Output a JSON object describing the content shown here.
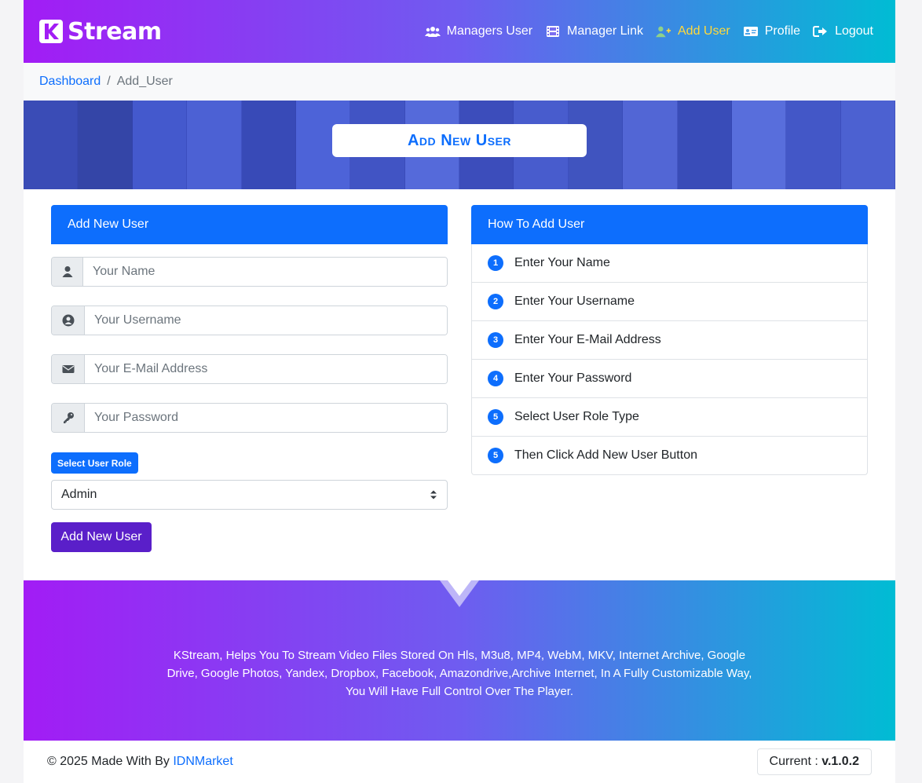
{
  "brand": {
    "name": "Stream"
  },
  "nav": {
    "items": [
      {
        "label": "Managers User",
        "icon": "users-icon"
      },
      {
        "label": "Manager Link",
        "icon": "film-icon"
      },
      {
        "label": "Add User",
        "icon": "user-plus-icon",
        "active": true
      },
      {
        "label": "Profile",
        "icon": "id-card-icon"
      },
      {
        "label": "Logout",
        "icon": "logout-icon"
      }
    ],
    "active_color": "#ffd93b"
  },
  "breadcrumb": {
    "home": "Dashboard",
    "separator": "/",
    "current": "Add_User"
  },
  "banner": {
    "title": "Add New User"
  },
  "form": {
    "header": "Add New User",
    "name_placeholder": "Your Name",
    "username_placeholder": "Your Username",
    "email_placeholder": "Your E-Mail Address",
    "password_placeholder": "Your Password",
    "role_label": "Select User Role",
    "role_selected": "Admin",
    "submit_label": "Add New User"
  },
  "howto": {
    "header": "How To Add User",
    "steps": [
      {
        "num": "1",
        "text": "Enter Your Name"
      },
      {
        "num": "2",
        "text": "Enter Your Username"
      },
      {
        "num": "3",
        "text": "Enter Your E-Mail Address"
      },
      {
        "num": "4",
        "text": "Enter Your Password"
      },
      {
        "num": "5",
        "text": "Select User Role Type"
      },
      {
        "num": "5",
        "text": "Then Click Add New User Button"
      }
    ]
  },
  "footer": {
    "text": "KStream, Helps You To Stream Video Files Stored On Hls, M3u8, MP4, WebM, MKV, Internet Archive, Google Drive, Google Photos, Yandex, Dropbox, Facebook, Amazondrive,Archive Internet, In A Fully Customizable Way, You Will Have Full Control Over The Player.",
    "made_prefix": "© 2025 Made With By",
    "made_link": "IDNMarket",
    "version_label": "Current :",
    "version_value": "v.1.0.2"
  },
  "colors": {
    "primary": "#0d6efd",
    "submit": "#5a1fc9",
    "gradient_start": "#a21cf5",
    "gradient_end": "#00bcd4"
  }
}
